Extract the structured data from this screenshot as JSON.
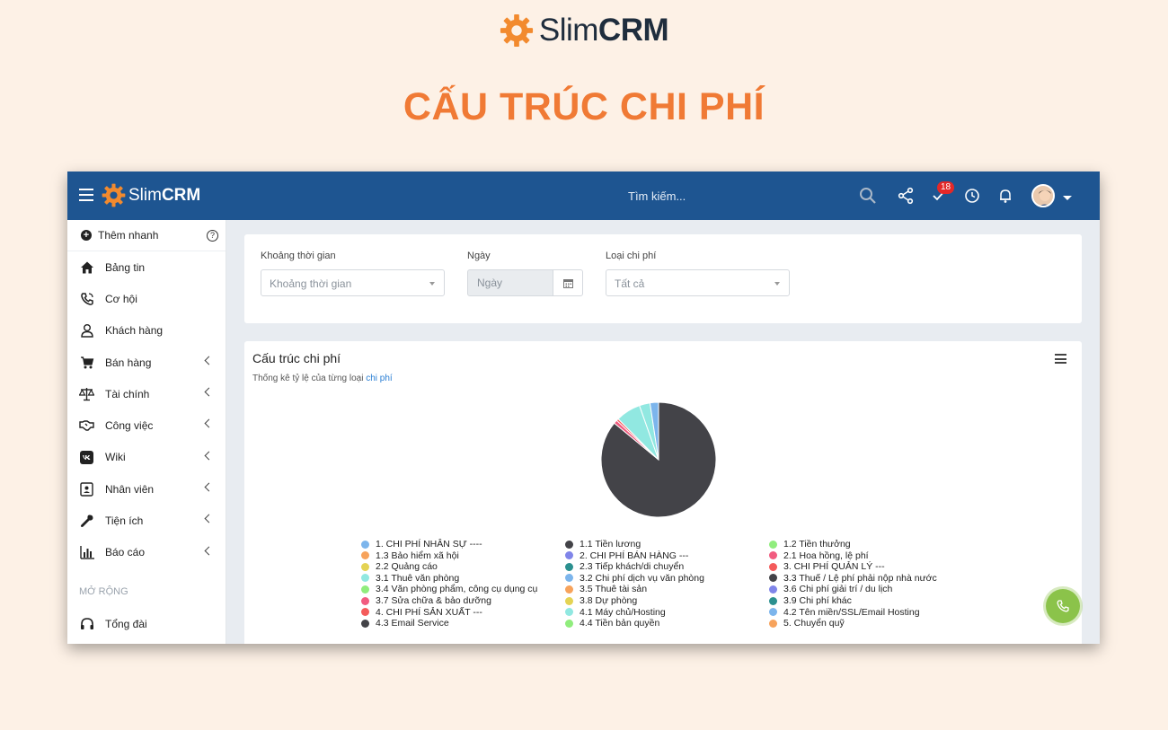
{
  "brand": {
    "name_light": "Slim",
    "name_bold": "CRM"
  },
  "page_title": "CẤU TRÚC CHI PHÍ",
  "topbar": {
    "logo_light": "Slim",
    "logo_bold": "CRM",
    "search_placeholder": "Tìm kiếm...",
    "task_badge": "18"
  },
  "sidebar": {
    "quick_add": "Thêm nhanh",
    "items": [
      {
        "label": "Bảng tin",
        "icon": "home-icon",
        "has_submenu": false
      },
      {
        "label": "Cơ hội",
        "icon": "phone-icon",
        "has_submenu": false
      },
      {
        "label": "Khách hàng",
        "icon": "user-icon",
        "has_submenu": false
      },
      {
        "label": "Bán hàng",
        "icon": "cart-icon",
        "has_submenu": true
      },
      {
        "label": "Tài chính",
        "icon": "scale-icon",
        "has_submenu": true
      },
      {
        "label": "Công việc",
        "icon": "handshake-icon",
        "has_submenu": true
      },
      {
        "label": "Wiki",
        "icon": "vk-icon",
        "has_submenu": true
      },
      {
        "label": "Nhân viên",
        "icon": "id-card-icon",
        "has_submenu": true
      },
      {
        "label": "Tiện ích",
        "icon": "wrench-icon",
        "has_submenu": true
      },
      {
        "label": "Báo cáo",
        "icon": "bar-chart-icon",
        "has_submenu": true
      }
    ],
    "section_label": "MỞ RỘNG",
    "extra_items": [
      {
        "label": "Tổng đài",
        "icon": "headset-icon"
      }
    ]
  },
  "filters": {
    "period_label": "Khoảng thời gian",
    "period_placeholder": "Khoảng thời gian",
    "date_label": "Ngày",
    "date_placeholder": "Ngày",
    "type_label": "Loại chi phí",
    "type_value": "Tất cả"
  },
  "chart_card": {
    "title": "Cấu trúc chi phí",
    "subtitle_prefix": "Thống kê tỷ lệ của từng loại",
    "subtitle_link": "chi phí"
  },
  "chart_data": {
    "type": "pie",
    "title": "Cấu trúc chi phí",
    "legend_position": "bottom",
    "slices": [
      {
        "label": "1.1 Tiền lương",
        "value": 86.0,
        "color": "#434348"
      },
      {
        "label": "2.1 Hoa hồng, lệ phí",
        "value": 1.0,
        "color": "#f15c80"
      },
      {
        "label": "3. CHI PHÍ QUẢN LÝ ---",
        "value": 0.6,
        "color": "#f45b5b"
      },
      {
        "label": "3.1 Thuê văn phòng",
        "value": 7.0,
        "color": "#91e8e1"
      },
      {
        "label": "4.1 Máy chủ/Hosting",
        "value": 3.0,
        "color": "#91e8e1"
      },
      {
        "label": "1. CHI PHÍ NHÂN SỰ ----",
        "value": 2.4,
        "color": "#7cb5ec"
      }
    ],
    "legend": [
      {
        "label": "1. CHI PHÍ NHÂN SỰ ----",
        "color": "#7cb5ec"
      },
      {
        "label": "1.1 Tiền lương",
        "color": "#434348"
      },
      {
        "label": "1.2 Tiền thưởng",
        "color": "#90ed7d"
      },
      {
        "label": "1.3 Bảo hiểm xã hội",
        "color": "#f7a35c"
      },
      {
        "label": "2. CHI PHÍ BÁN HÀNG ---",
        "color": "#8085e9"
      },
      {
        "label": "2.1 Hoa hồng, lệ phí",
        "color": "#f15c80"
      },
      {
        "label": "2.2 Quảng cáo",
        "color": "#e4d354"
      },
      {
        "label": "2.3 Tiếp khách/di chuyển",
        "color": "#2b908f"
      },
      {
        "label": "3. CHI PHÍ QUẢN LÝ ---",
        "color": "#f45b5b"
      },
      {
        "label": "3.1 Thuê văn phòng",
        "color": "#91e8e1"
      },
      {
        "label": "3.2 Chi phí dịch vụ văn phòng",
        "color": "#7cb5ec"
      },
      {
        "label": "3.3 Thuế / Lệ phí phải nộp nhà nước",
        "color": "#434348"
      },
      {
        "label": "3.4 Văn phòng phẩm, công cụ dụng cụ",
        "color": "#90ed7d"
      },
      {
        "label": "3.5 Thuê tài sản",
        "color": "#f7a35c"
      },
      {
        "label": "3.6 Chi phí giải trí / du lịch",
        "color": "#8085e9"
      },
      {
        "label": "3.7 Sửa chữa & bảo dưỡng",
        "color": "#f15c80"
      },
      {
        "label": "3.8 Dự phòng",
        "color": "#e4d354"
      },
      {
        "label": "3.9 Chi phí khác",
        "color": "#2b908f"
      },
      {
        "label": "4. CHI PHÍ SẢN XUẤT ---",
        "color": "#f45b5b"
      },
      {
        "label": "4.1 Máy chủ/Hosting",
        "color": "#91e8e1"
      },
      {
        "label": "4.2 Tên miền/SSL/Email Hosting",
        "color": "#7cb5ec"
      },
      {
        "label": "4.3 Email Service",
        "color": "#434348"
      },
      {
        "label": "4.4 Tiền bản quyền",
        "color": "#90ed7d"
      },
      {
        "label": "5. Chuyển quỹ",
        "color": "#f7a35c"
      }
    ]
  },
  "colors": {
    "page_bg": "#fdf1e6",
    "title_orange": "#f07a35",
    "topbar_blue": "#1e5591",
    "gear_orange": "#f28a2e",
    "call_green": "#8bc34a"
  }
}
